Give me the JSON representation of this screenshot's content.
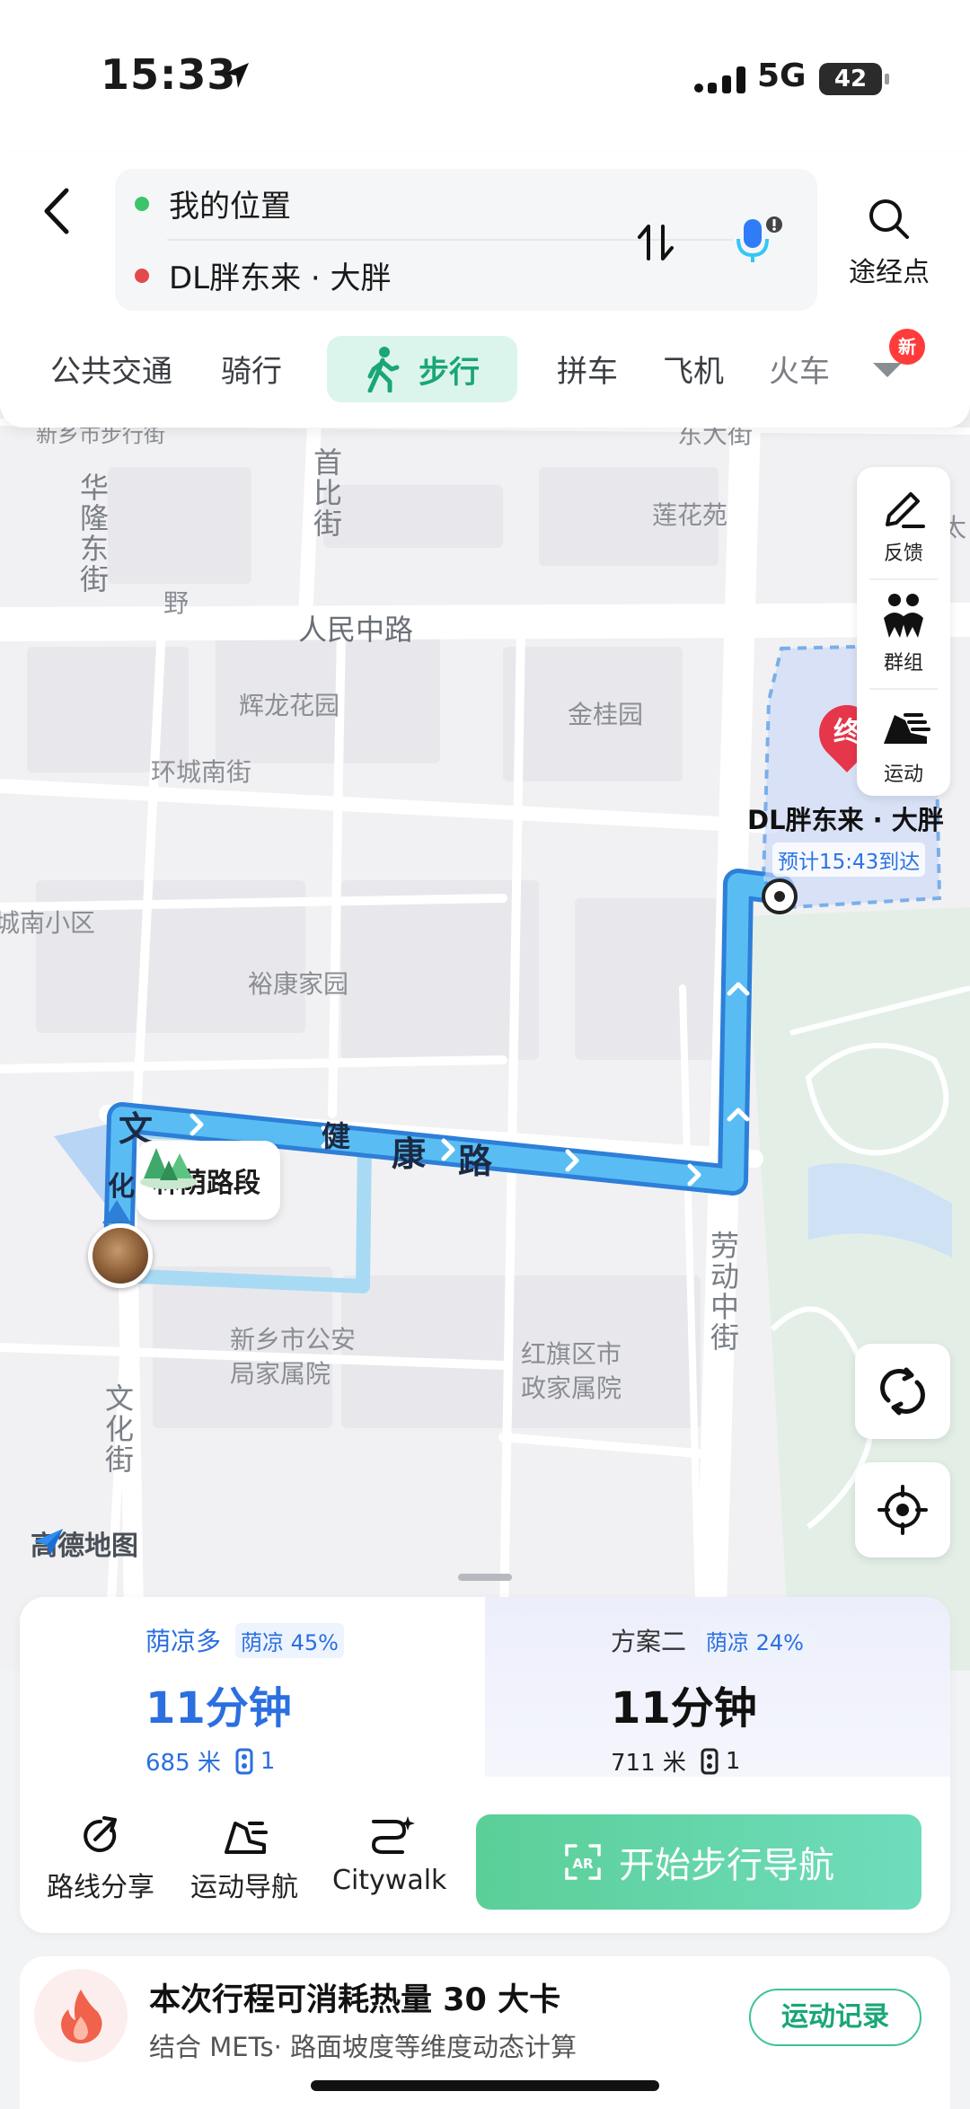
{
  "status_bar": {
    "time": "15:33",
    "network": "5G",
    "battery": "42"
  },
  "header": {
    "origin": "我的位置",
    "destination": "DL胖东来 · 大胖",
    "waypoint_label": "途经点",
    "colors": {
      "origin_dot": "#3cc46a",
      "destination_dot": "#e24a4a"
    }
  },
  "modes": {
    "items": [
      "公共交通",
      "骑行",
      "步行",
      "拼车",
      "飞机",
      "火车"
    ],
    "active": "步行",
    "new_badge": "新"
  },
  "toolbar": {
    "feedback": "反馈",
    "group": "群组",
    "sport": "运动"
  },
  "map": {
    "labels": {
      "top_left": "新乡市步行街",
      "top_right": "东大街",
      "hualong": "华隆东街",
      "ye": "野",
      "shoubi": "首比街",
      "lianhuayuan": "莲花苑",
      "right_edge": "太",
      "renmin": "人民中路",
      "huilong": "辉龙花园",
      "jingui": "金桂园",
      "huancheng": "环城南街",
      "chengnan": "城南小区",
      "yukang": "裕康家园",
      "jiankang": [
        "文",
        "健",
        "康",
        "路"
      ],
      "wenhua_top": "化",
      "laodong": "劳动中街",
      "gongan": [
        "新乡市公安",
        "局家属院"
      ],
      "hongqi": [
        "红旗区市",
        "政家属院"
      ],
      "wenhua": "文化街",
      "left_edge": "高"
    },
    "destination_marker": "终",
    "destination_label": "DL胖东来 · 大胖",
    "eta": "预计15:43到达",
    "shade_segment": "林荫路段",
    "logo": "高德地图",
    "colors": {
      "route": "#3aa3ef",
      "route_edge": "#2d7fd8",
      "park": "#e3efe6"
    }
  },
  "plans": [
    {
      "name": "荫凉多",
      "tag": "荫凉 45%",
      "duration": "11分钟",
      "distance": "685 米",
      "lights": "1",
      "selected": true
    },
    {
      "name": "方案二",
      "tag": "荫凉 24%",
      "duration": "11分钟",
      "distance": "711 米",
      "lights": "1",
      "selected": false
    }
  ],
  "actions": {
    "share": "路线分享",
    "sport_nav": "运动导航",
    "citywalk": "Citywalk",
    "start": "开始步行导航"
  },
  "calorie": {
    "title": "本次行程可消耗热量 30 大卡",
    "subtitle": "结合 METs· 路面坡度等维度动态计算",
    "record": "运动记录"
  }
}
